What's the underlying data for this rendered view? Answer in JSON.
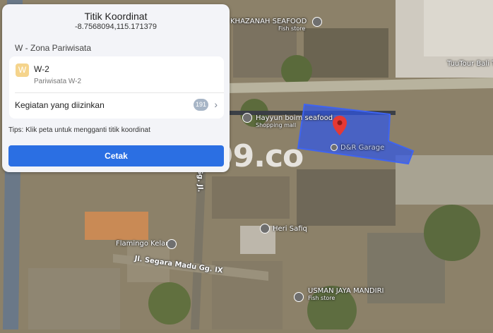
{
  "panel": {
    "title": "Titik Koordinat",
    "coordinates": "-8.7568094,115.171379",
    "zone_heading": "W - Zona Pariwisata",
    "zone": {
      "badge": "W",
      "code": "W-2",
      "name": "Pariwisata W-2"
    },
    "activities": {
      "label": "Kegiatan yang diizinkan",
      "count": "191",
      "chevron": "›"
    },
    "tip": "Tips: Klik peta untuk mengganti titik koordinat",
    "print_button": "Cetak"
  },
  "map": {
    "places": [
      {
        "name": "KHAZANAH SEAFOOD",
        "category": "Fish store"
      },
      {
        "name": "TuuTour Bali T",
        "category": ""
      },
      {
        "name": "Hayyun boim seafood",
        "category": "Shopping mall"
      },
      {
        "name": "D&R Garage",
        "category": ""
      },
      {
        "name": "Heri Safiq",
        "category": ""
      },
      {
        "name": "Flamingo Kelan",
        "category": ""
      },
      {
        "name": "USMAN JAYA MANDIRI",
        "category": "Fish store"
      }
    ],
    "roads": [
      "Jl. Segara Madu Gg. IX",
      "Gg. Jl."
    ],
    "parcel_color": "#2f56e6",
    "marker_color": "#e53935"
  },
  "watermark": {
    "text": "99.co"
  }
}
